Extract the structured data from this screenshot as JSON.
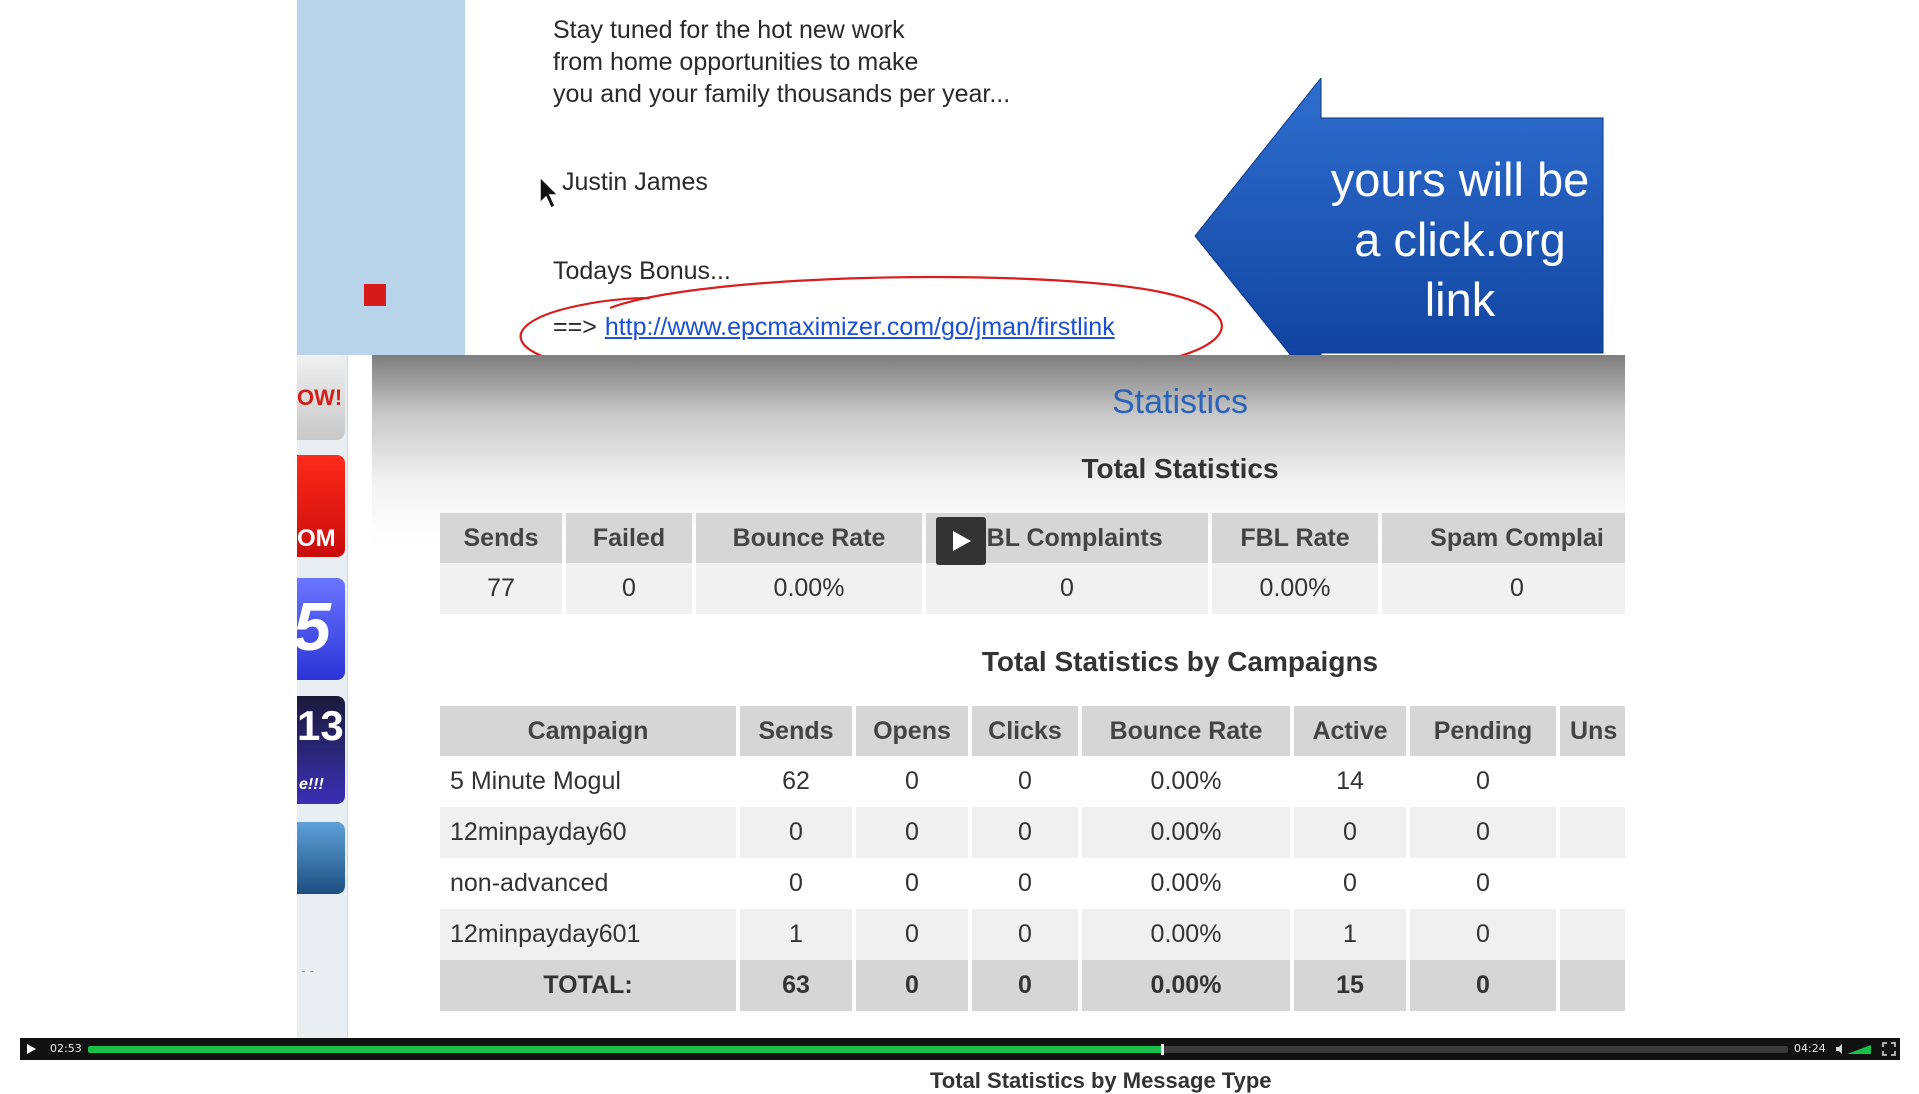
{
  "email": {
    "lines": [
      "Stay tuned for the hot new work",
      "from home opportunities to make",
      "you and your family thousands per year..."
    ],
    "signature": "Justin James",
    "bonus_heading": "Todays Bonus...",
    "bonus_arrow": "==>",
    "bonus_link": "http://www.epcmaximizer.com/go/jman/firstlink"
  },
  "callout": {
    "lines": [
      "yours will be",
      "a click.org",
      "link"
    ],
    "color": "#1a55b8"
  },
  "side_icons": {
    "now": "OW!",
    "om": "OM",
    "five": "5",
    "thirteen": "13",
    "thirteen_sub": "e!!!",
    "dots": "- -"
  },
  "stats": {
    "title": "Statistics",
    "total_title": "Total Statistics",
    "total_headers": [
      "Sends",
      "Failed",
      "Bounce Rate",
      "FBL Complaints",
      "FBL Rate",
      "Spam Complai"
    ],
    "total_values": [
      "77",
      "0",
      "0.00%",
      "0",
      "0.00%",
      "0"
    ],
    "campaign_title": "Total Statistics by Campaigns",
    "campaign_headers": [
      "Campaign",
      "Sends",
      "Opens",
      "Clicks",
      "Bounce Rate",
      "Active",
      "Pending",
      "Uns"
    ],
    "campaign_rows": [
      [
        "5 Minute Mogul",
        "62",
        "0",
        "0",
        "0.00%",
        "14",
        "0",
        ""
      ],
      [
        "12minpayday60",
        "0",
        "0",
        "0",
        "0.00%",
        "0",
        "0",
        ""
      ],
      [
        "non-advanced",
        "0",
        "0",
        "0",
        "0.00%",
        "0",
        "0",
        ""
      ],
      [
        "12minpayday601",
        "1",
        "0",
        "0",
        "0.00%",
        "1",
        "0",
        ""
      ]
    ],
    "campaign_total": [
      "TOTAL:",
      "63",
      "0",
      "0",
      "0.00%",
      "15",
      "0",
      ""
    ],
    "below_text": "Total Statistics by Message Type"
  },
  "player": {
    "elapsed": "02:53",
    "total": "04:24",
    "progress": 0.6318,
    "accent": "#18c04a"
  }
}
